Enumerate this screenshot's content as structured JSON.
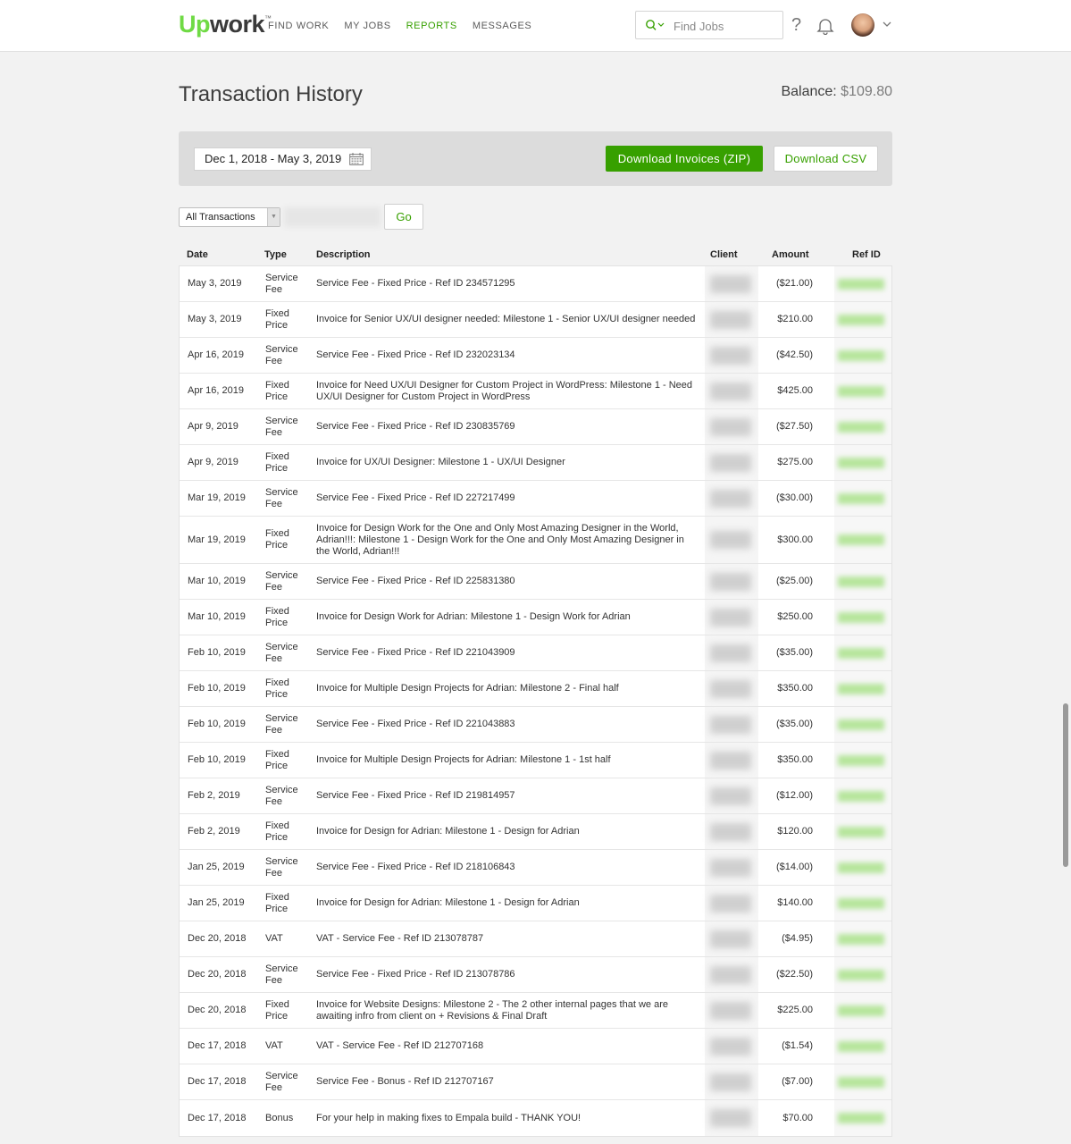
{
  "header": {
    "logo_up": "Up",
    "logo_work": "work",
    "logo_tm": "™",
    "nav": [
      "FIND WORK",
      "MY JOBS",
      "REPORTS",
      "MESSAGES"
    ],
    "active_nav": "REPORTS",
    "search_placeholder": "Find Jobs",
    "help_label": "?"
  },
  "colors": {
    "accent": "#37a000",
    "logo_green": "#6fda44"
  },
  "page": {
    "title": "Transaction History",
    "balance_label": "Balance:",
    "balance_value": "$109.80"
  },
  "filters": {
    "date_range": "Dec 1, 2018 - May 3, 2019",
    "download_zip": "Download Invoices (ZIP)",
    "download_csv": "Download CSV",
    "transaction_type": "All Transactions",
    "go": "Go"
  },
  "table": {
    "columns": {
      "date": "Date",
      "type": "Type",
      "description": "Description",
      "client": "Client",
      "amount": "Amount",
      "ref_id": "Ref ID"
    },
    "rows": [
      {
        "date": "May 3, 2019",
        "type": "Service Fee",
        "description": "Service Fee - Fixed Price - Ref ID 234571295",
        "amount": "($21.00)"
      },
      {
        "date": "May 3, 2019",
        "type": "Fixed Price",
        "description": "Invoice for Senior UX/UI designer needed: Milestone 1 - Senior UX/UI designer needed",
        "amount": "$210.00"
      },
      {
        "date": "Apr 16, 2019",
        "type": "Service Fee",
        "description": "Service Fee - Fixed Price - Ref ID 232023134",
        "amount": "($42.50)"
      },
      {
        "date": "Apr 16, 2019",
        "type": "Fixed Price",
        "description": "Invoice for Need UX/UI Designer for Custom Project in WordPress: Milestone 1 - Need UX/UI Designer for Custom Project in WordPress",
        "amount": "$425.00"
      },
      {
        "date": "Apr 9, 2019",
        "type": "Service Fee",
        "description": "Service Fee - Fixed Price - Ref ID 230835769",
        "amount": "($27.50)"
      },
      {
        "date": "Apr 9, 2019",
        "type": "Fixed Price",
        "description": "Invoice for UX/UI Designer: Milestone 1 - UX/UI Designer",
        "amount": "$275.00"
      },
      {
        "date": "Mar 19, 2019",
        "type": "Service Fee",
        "description": "Service Fee - Fixed Price - Ref ID 227217499",
        "amount": "($30.00)"
      },
      {
        "date": "Mar 19, 2019",
        "type": "Fixed Price",
        "description": "Invoice for Design Work for the One and Only Most Amazing Designer in the World, Adrian!!!: Milestone 1 - Design Work for the One and Only Most Amazing Designer in the World, Adrian!!!",
        "amount": "$300.00",
        "tall": true
      },
      {
        "date": "Mar 10, 2019",
        "type": "Service Fee",
        "description": "Service Fee - Fixed Price - Ref ID 225831380",
        "amount": "($25.00)"
      },
      {
        "date": "Mar 10, 2019",
        "type": "Fixed Price",
        "description": "Invoice for Design Work for Adrian: Milestone 1 - Design Work for Adrian",
        "amount": "$250.00"
      },
      {
        "date": "Feb 10, 2019",
        "type": "Service Fee",
        "description": "Service Fee - Fixed Price - Ref ID 221043909",
        "amount": "($35.00)"
      },
      {
        "date": "Feb 10, 2019",
        "type": "Fixed Price",
        "description": "Invoice for Multiple Design Projects for Adrian: Milestone 2 - Final half",
        "amount": "$350.00"
      },
      {
        "date": "Feb 10, 2019",
        "type": "Service Fee",
        "description": "Service Fee - Fixed Price - Ref ID 221043883",
        "amount": "($35.00)"
      },
      {
        "date": "Feb 10, 2019",
        "type": "Fixed Price",
        "description": "Invoice for Multiple Design Projects for Adrian: Milestone 1 - 1st half",
        "amount": "$350.00"
      },
      {
        "date": "Feb 2, 2019",
        "type": "Service Fee",
        "description": "Service Fee - Fixed Price - Ref ID 219814957",
        "amount": "($12.00)"
      },
      {
        "date": "Feb 2, 2019",
        "type": "Fixed Price",
        "description": "Invoice for Design for Adrian: Milestone 1 - Design for Adrian",
        "amount": "$120.00"
      },
      {
        "date": "Jan 25, 2019",
        "type": "Service Fee",
        "description": "Service Fee - Fixed Price - Ref ID 218106843",
        "amount": "($14.00)"
      },
      {
        "date": "Jan 25, 2019",
        "type": "Fixed Price",
        "description": "Invoice for Design for Adrian: Milestone 1 - Design for Adrian",
        "amount": "$140.00"
      },
      {
        "date": "Dec 20, 2018",
        "type": "VAT",
        "description": "VAT - Service Fee - Ref ID 213078787",
        "amount": "($4.95)"
      },
      {
        "date": "Dec 20, 2018",
        "type": "Service Fee",
        "description": "Service Fee - Fixed Price - Ref ID 213078786",
        "amount": "($22.50)"
      },
      {
        "date": "Dec 20, 2018",
        "type": "Fixed Price",
        "description": "Invoice for Website Designs: Milestone 2 - The 2 other internal pages that we are awaiting infro from client on + Revisions & Final Draft",
        "amount": "$225.00"
      },
      {
        "date": "Dec 17, 2018",
        "type": "VAT",
        "description": "VAT - Service Fee - Ref ID 212707168",
        "amount": "($1.54)"
      },
      {
        "date": "Dec 17, 2018",
        "type": "Service Fee",
        "description": "Service Fee - Bonus - Ref ID 212707167",
        "amount": "($7.00)"
      },
      {
        "date": "Dec 17, 2018",
        "type": "Bonus",
        "description": "For your help in making fixes to Empala build - THANK YOU!",
        "amount": "$70.00"
      }
    ]
  }
}
